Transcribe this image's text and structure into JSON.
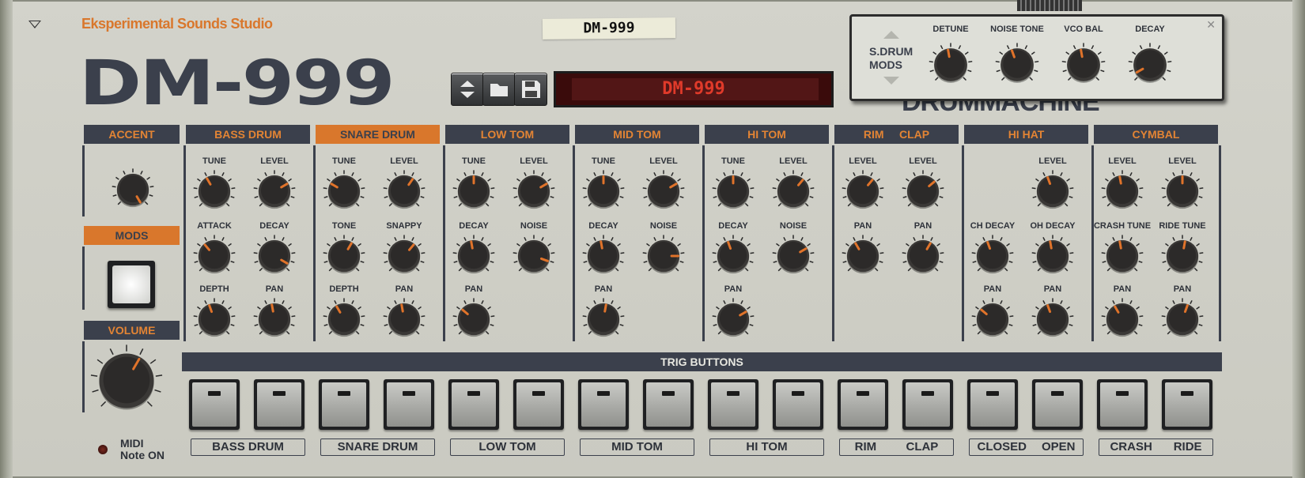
{
  "header": {
    "maker": "Eksperimental Sounds Studio",
    "patch_tape": "DM-999",
    "logo": "DM-999",
    "lcd": "DM-999",
    "bg_title": "DRUMMACHINE"
  },
  "mods_panel": {
    "title": "S.DRUM\nMODS",
    "knobs": [
      {
        "label": "DETUNE",
        "angle": -10
      },
      {
        "label": "NOISE TONE",
        "angle": -20
      },
      {
        "label": "VCO BAL",
        "angle": -10
      },
      {
        "label": "DECAY",
        "angle": -120
      }
    ]
  },
  "left": {
    "accent": "ACCENT",
    "mods": "MODS",
    "volume": "VOLUME",
    "midi": "MIDI\nNote ON"
  },
  "sections": [
    {
      "title": "BASS DRUM",
      "orange": false
    },
    {
      "title": "SNARE DRUM",
      "orange": true
    },
    {
      "title": "LOW TOM",
      "orange": false
    },
    {
      "title": "MID TOM",
      "orange": false
    },
    {
      "title": "HI TOM",
      "orange": false
    },
    {
      "title": "RIM     CLAP",
      "orange": false
    },
    {
      "title": "HI HAT",
      "orange": false
    },
    {
      "title": "CYMBAL",
      "orange": false
    }
  ],
  "knob_labels": {
    "bd": [
      "TUNE",
      "LEVEL",
      "ATTACK",
      "DECAY",
      "DEPTH",
      "PAN"
    ],
    "sd": [
      "TUNE",
      "LEVEL",
      "TONE",
      "SNAPPY",
      "DEPTH",
      "PAN"
    ],
    "lt": [
      "TUNE",
      "LEVEL",
      "DECAY",
      "NOISE",
      "PAN"
    ],
    "mt": [
      "TUNE",
      "LEVEL",
      "DECAY",
      "NOISE",
      "PAN"
    ],
    "ht": [
      "TUNE",
      "LEVEL",
      "DECAY",
      "NOISE",
      "PAN"
    ],
    "rc": [
      "LEVEL",
      "LEVEL",
      "PAN",
      "PAN"
    ],
    "hh": [
      "LEVEL",
      "CH DECAY",
      "OH DECAY",
      "PAN",
      "PAN"
    ],
    "cy": [
      "LEVEL",
      "LEVEL",
      "CRASH TUNE",
      "RIDE TUNE",
      "PAN",
      "PAN"
    ]
  },
  "trig": {
    "title": "TRIG BUTTONS",
    "labels": [
      "BASS DRUM",
      "SNARE DRUM",
      "LOW TOM",
      "MID TOM",
      "HI TOM"
    ],
    "pairs": [
      [
        "RIM",
        "CLAP"
      ],
      [
        "CLOSED",
        "OPEN"
      ],
      [
        "CRASH",
        "RIDE"
      ]
    ]
  },
  "colors": {
    "accent": "#d9772c",
    "dark": "#3b404c"
  }
}
